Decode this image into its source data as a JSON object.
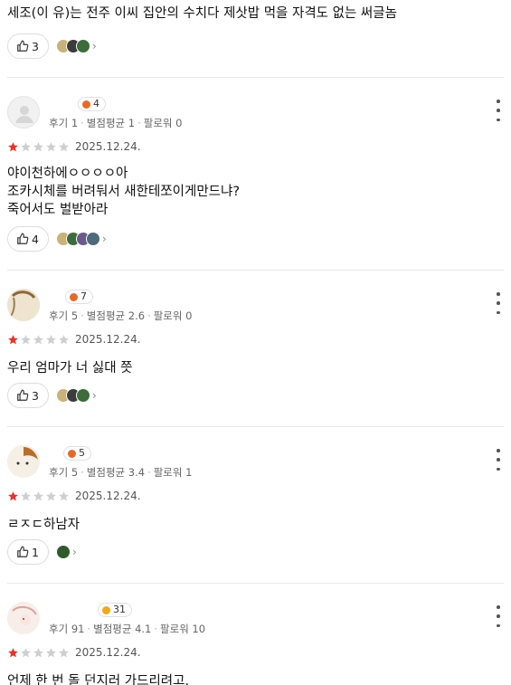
{
  "reviews": [
    {
      "text_lines": [
        "세조(이 유)는 전주 이씨 집안의 수치다 제삿밥 먹을 자격도 없는 써글놈"
      ],
      "likes": "3"
    },
    {
      "username": "",
      "level": "4",
      "meta": {
        "reviews": "후기 1",
        "avg": "별점평균 1",
        "followers": "팔로워 0"
      },
      "stars": 1,
      "date": "2025.12.24.",
      "text_lines": [
        "야이천하에ㅇㅇㅇㅇ아",
        "조카시체를 버려둬서 새한테쪼이게만드냐?",
        "죽어서도 벌받아라"
      ],
      "likes": "4"
    },
    {
      "username": "",
      "level": "7",
      "meta": {
        "reviews": "후기 5",
        "avg": "별점평균 2.6",
        "followers": "팔로워 0"
      },
      "stars": 1,
      "date": "2025.12.24.",
      "text_lines": [
        "우리 엄마가 너 싫대 쯧"
      ],
      "likes": "3"
    },
    {
      "username": "",
      "level": "5",
      "meta": {
        "reviews": "후기 5",
        "avg": "별점평균 3.4",
        "followers": "팔로워 1"
      },
      "stars": 1,
      "date": "2025.12.24.",
      "text_lines": [
        "ㄹㅈㄷ하남자"
      ],
      "likes": "1"
    },
    {
      "username": "",
      "level": "31",
      "meta": {
        "reviews": "후기 91",
        "avg": "별점평균 4.1",
        "followers": "팔로워 10"
      },
      "stars": 1,
      "date": "2025.12.24.",
      "text_lines": [
        "언제 한 번 돌 던지러 가드리려고."
      ]
    }
  ],
  "colors": {
    "star_on": "#e0362c",
    "star_off": "#cfcfcf",
    "medal": "#e46a2a",
    "medal_gold": "#f0a81c"
  },
  "icons": {
    "like": "thumbs-up-icon",
    "more": "more-vertical-icon",
    "chevron": "chevron-right-icon",
    "star": "star-icon"
  }
}
